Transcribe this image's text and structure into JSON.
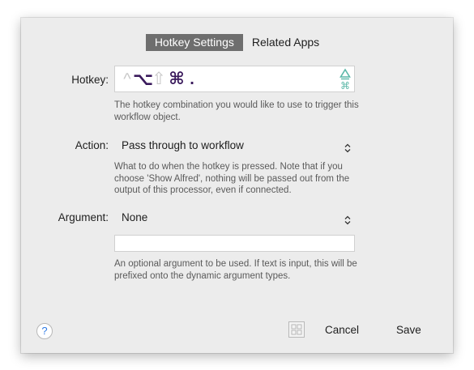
{
  "tabs": [
    {
      "label": "Hotkey Settings",
      "active": true
    },
    {
      "label": "Related Apps",
      "active": false
    }
  ],
  "hotkey": {
    "label": "Hotkey:",
    "glyphs": {
      "ctrl": "^",
      "option": "⌥",
      "shift": "⇧",
      "command": "⌘",
      "key": "."
    },
    "active_modifiers": [
      "option",
      "command"
    ],
    "inactive_modifiers": [
      "ctrl",
      "shift"
    ],
    "help": "The hotkey combination you would like to use to trigger this workflow object."
  },
  "action": {
    "label": "Action:",
    "value": "Pass through to workflow",
    "help": "What to do when the hotkey is pressed. Note that if you choose 'Show Alfred', nothing will be passed out from the output of this processor, even if connected."
  },
  "argument": {
    "label": "Argument:",
    "value": "None",
    "input_value": "",
    "help": "An optional argument to be used. If text is input, this will be prefixed onto the dynamic argument types."
  },
  "footer": {
    "help_glyph": "?",
    "cancel_label": "Cancel",
    "save_label": "Save"
  },
  "icons": {
    "help": "question-mark-icon",
    "popup": "up-down-chevron-icon",
    "grid": "grid-icon",
    "hotkey_type": "triangle-command-icon"
  },
  "colors": {
    "active_modifier": "#3a1a5c",
    "inactive_modifier": "#c8c8c8",
    "accent_teal": "#5cb8a8",
    "help_blue": "#2f7be6",
    "active_tab_bg": "#6e6e6e"
  }
}
